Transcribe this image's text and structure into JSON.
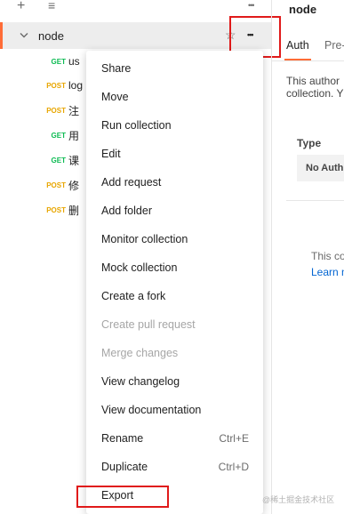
{
  "sidebar": {
    "toolbar": {
      "add_icon": "+",
      "filter_icon": "≡",
      "more_icon": "•••"
    },
    "collection": {
      "name": "node",
      "star_icon": "☆",
      "more_icon": "•••"
    },
    "requests": [
      {
        "method": "GET",
        "name": "us"
      },
      {
        "method": "POST",
        "name": "log"
      },
      {
        "method": "POST",
        "name": "注"
      },
      {
        "method": "GET",
        "name": "用"
      },
      {
        "method": "GET",
        "name": "课"
      },
      {
        "method": "POST",
        "name": "修"
      },
      {
        "method": "POST",
        "name": "删"
      }
    ]
  },
  "right_panel": {
    "title": "node",
    "tabs": [
      "Auth",
      "Pre-"
    ],
    "description_line1": "This author",
    "description_line2": "collection. Y",
    "type_label": "Type",
    "type_value": "No Auth",
    "info_line1": "This co",
    "learn_link": "Learn m"
  },
  "context_menu": {
    "items": [
      {
        "label": "Share",
        "shortcut": "",
        "disabled": false
      },
      {
        "label": "Move",
        "shortcut": "",
        "disabled": false
      },
      {
        "label": "Run collection",
        "shortcut": "",
        "disabled": false
      },
      {
        "label": "Edit",
        "shortcut": "",
        "disabled": false
      },
      {
        "label": "Add request",
        "shortcut": "",
        "disabled": false
      },
      {
        "label": "Add folder",
        "shortcut": "",
        "disabled": false
      },
      {
        "label": "Monitor collection",
        "shortcut": "",
        "disabled": false
      },
      {
        "label": "Mock collection",
        "shortcut": "",
        "disabled": false
      },
      {
        "label": "Create a fork",
        "shortcut": "",
        "disabled": false
      },
      {
        "label": "Create pull request",
        "shortcut": "",
        "disabled": true
      },
      {
        "label": "Merge changes",
        "shortcut": "",
        "disabled": true
      },
      {
        "label": "View changelog",
        "shortcut": "",
        "disabled": false
      },
      {
        "label": "View documentation",
        "shortcut": "",
        "disabled": false
      },
      {
        "label": "Rename",
        "shortcut": "Ctrl+E",
        "disabled": false
      },
      {
        "label": "Duplicate",
        "shortcut": "Ctrl+D",
        "disabled": false
      },
      {
        "label": "Export",
        "shortcut": "",
        "disabled": false
      }
    ]
  },
  "watermark": "@稀土掘金技术社区",
  "colors": {
    "accent": "#ff6c37",
    "get": "#0cbb52",
    "post": "#e8a600",
    "highlight": "#e01a1a"
  }
}
